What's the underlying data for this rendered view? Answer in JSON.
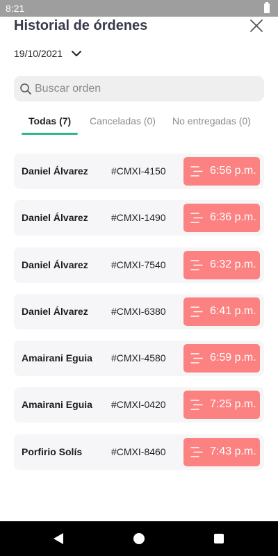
{
  "status_bar": {
    "time": "8:21"
  },
  "header": {
    "title": "Historial de órdenes"
  },
  "date_selector": {
    "date": "19/10/2021"
  },
  "search": {
    "placeholder": "Buscar orden",
    "value": ""
  },
  "tabs": [
    {
      "label": "Todas (7)",
      "active": true
    },
    {
      "label": "Canceladas (0)",
      "active": false
    },
    {
      "label": "No entregadas (0)",
      "active": false
    }
  ],
  "orders": [
    {
      "name": "Daniel Álvarez",
      "order_id": "#CMXI-4150",
      "time": "6:56 p.m."
    },
    {
      "name": "Daniel Álvarez",
      "order_id": "#CMXI-1490",
      "time": "6:36 p.m."
    },
    {
      "name": "Daniel Álvarez",
      "order_id": "#CMXI-7540",
      "time": "6:32 p.m."
    },
    {
      "name": "Daniel Álvarez",
      "order_id": "#CMXI-6380",
      "time": "6:41 p.m."
    },
    {
      "name": "Amairani Eguia",
      "order_id": "#CMXI-4580",
      "time": "6:59 p.m."
    },
    {
      "name": "Amairani Eguia",
      "order_id": "#CMXI-0420",
      "time": "7:25 p.m."
    },
    {
      "name": "Porfirio Solís",
      "order_id": "#CMXI-8460",
      "time": "7:43 p.m."
    }
  ],
  "colors": {
    "accent": "#2fb88d",
    "time_badge": "#fc8181",
    "title": "#37394a"
  },
  "icons": {
    "close": "close-icon",
    "date": "chevron-down-icon",
    "search": "search-icon",
    "order": "order-lines-icon"
  }
}
